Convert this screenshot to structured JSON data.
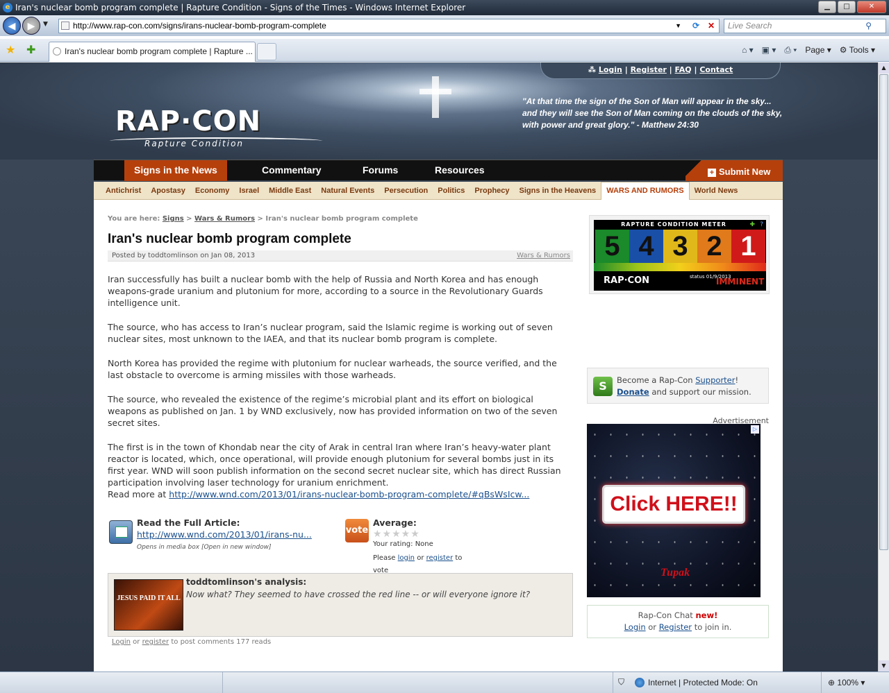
{
  "window": {
    "title": "Iran's nuclear bomb program complete | Rapture Condition - Signs of the Times - Windows Internet Explorer",
    "address": "http://www.rap-con.com/signs/irans-nuclear-bomb-program-complete",
    "search_placeholder": "Live Search",
    "tab_title": "Iran's nuclear bomb program complete | Rapture ...",
    "tools": {
      "page": "Page",
      "tools": "Tools"
    }
  },
  "header": {
    "toplinks": [
      "Login",
      "Register",
      "FAQ",
      "Contact"
    ],
    "logo": "RAP·CON",
    "logo_sub": "Rapture Condition",
    "quote": "\"At that time the sign of the Son of Man will appear in the sky... and they will see the Son of Man coming on the clouds of the sky, with power and great glory.\" - Matthew 24:30"
  },
  "mainnav": {
    "items": [
      "Signs in the News",
      "Commentary",
      "Forums",
      "Resources"
    ],
    "submit": "Submit New"
  },
  "subnav": [
    "Antichrist",
    "Apostasy",
    "Economy",
    "Israel",
    "Middle East",
    "Natural Events",
    "Persecution",
    "Politics",
    "Prophecy",
    "Signs in the Heavens",
    "WARS AND RUMORS",
    "World News"
  ],
  "breadcrumb": {
    "prefix": "You are here:",
    "level1": "Signs",
    "level2": "Wars & Rumors",
    "current": "Iran's nuclear bomb program complete"
  },
  "article": {
    "title": "Iran's nuclear bomb program complete",
    "meta": "Posted by toddtomlinson on Jan 08, 2013",
    "category": "Wars & Rumors",
    "paragraphs": [
      "Iran successfully has built a nuclear bomb with the help of Russia and North Korea and has enough weapons-grade uranium and plutonium for more, according to a source in the Revolutionary Guards intelligence unit.",
      "The source, who has access to Iran’s nuclear program, said the Islamic regime is working out of seven nuclear sites, most unknown to the IAEA, and that its nuclear bomb program is complete.",
      "North Korea has provided the regime with plutonium for nuclear warheads, the source verified, and the last obstacle to overcome is arming missiles with those warheads.",
      "The source, who revealed the existence of the regime’s microbial plant and its effort on biological weapons as published on Jan. 1 by WND exclusively, now has provided information on two of the seven secret sites.",
      "The first is in the town of Khondab near the city of Arak in central Iran where Iran’s heavy-water plant reactor is located, which, once operational, will provide enough plutonium for several bombs just in its first year. WND will soon publish information on the second secret nuclear site, which has direct Russian participation involving laser technology for uranium enrichment."
    ],
    "readmore_prefix": "Read more at",
    "readmore_link": "http://www.wnd.com/2013/01/irans-nuclear-bomb-program-complete/#qBsWsIcw...",
    "full_label": "Read the Full Article:",
    "full_link": "http://www.wnd.com/2013/01/irans-nu...",
    "full_note": "Opens in media box [Open in new window]",
    "vote_badge": "vote",
    "vote_label": "Average:",
    "stars": "★★★★★",
    "your_rating": "Your rating: None",
    "vote_please": "Please",
    "vote_login": "login",
    "vote_or": "or",
    "vote_register": "register",
    "vote_to": "to vote"
  },
  "analysis": {
    "image_text": "JESUS PAID IT ALL",
    "who": "toddtomlinson's analysis:",
    "text": "Now what? They seemed to have crossed the red line -- or will everyone ignore it?"
  },
  "comments": {
    "login": "Login",
    "or": "or",
    "register": "register",
    "rest": "to post comments 177 reads"
  },
  "sidebar": {
    "meter_title": "RAPTURE CONDITION METER",
    "meter_numbers": [
      "5",
      "4",
      "3",
      "2",
      "1"
    ],
    "meter_colors": [
      "#1a8a2a",
      "#1a4fa8",
      "#e0b81a",
      "#e07a1a",
      "#d01a1a"
    ],
    "meter_brand": "RAP·CON",
    "meter_status": "status 01/9/2013",
    "meter_level": "IMMINENT",
    "support_prefix": "Become a Rap-Con",
    "support_link": "Supporter",
    "donate": "Donate",
    "donate_rest": "and support our mission.",
    "ad_label": "Advertisement",
    "ad_text": "Click HERE!!",
    "ad_brand": "Tupak",
    "chat_title": "Rap-Con Chat",
    "chat_new": "new!",
    "chat_login": "Login",
    "chat_or": "or",
    "chat_register": "Register",
    "chat_rest": "to join in."
  },
  "status": {
    "zone": "Internet | Protected Mode: On",
    "zoom": "100%"
  }
}
